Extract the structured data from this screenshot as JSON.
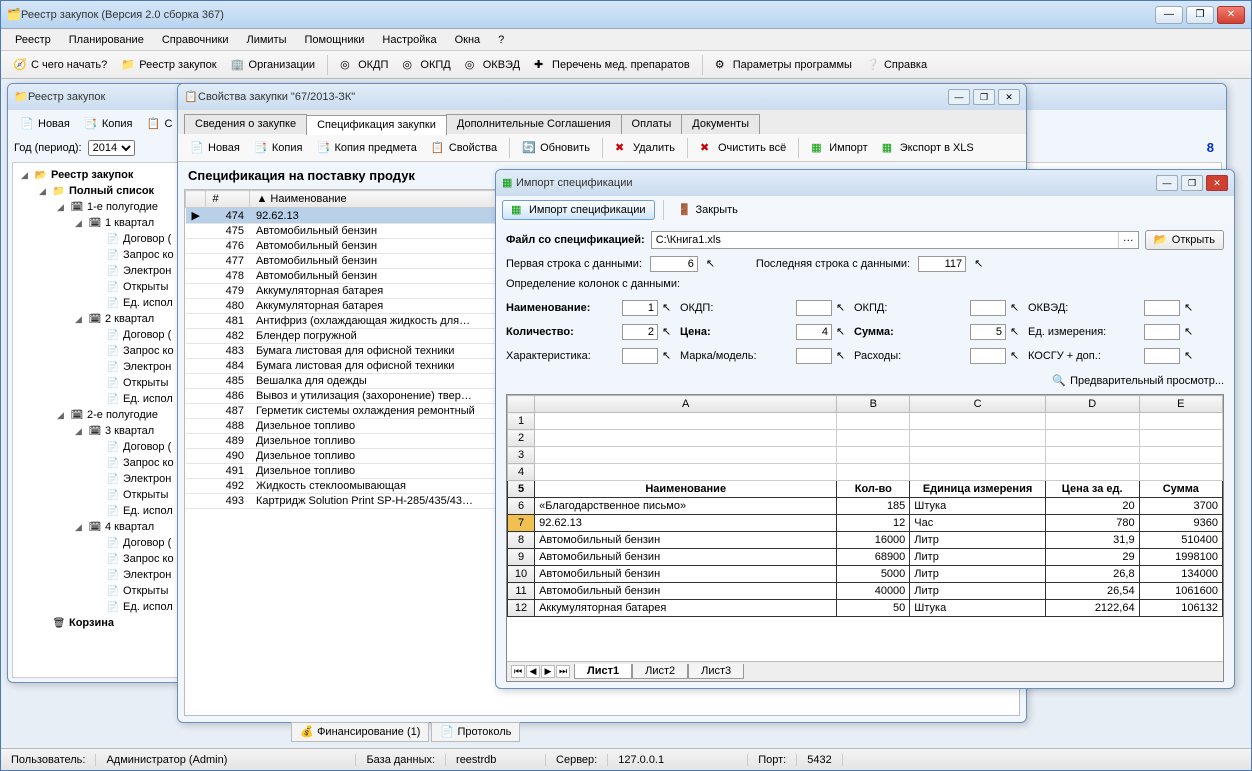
{
  "app": {
    "title": "Реестр закупок (Версия 2.0 сборка 367)"
  },
  "menu": [
    "Реестр",
    "Планирование",
    "Справочники",
    "Лимиты",
    "Помощники",
    "Настройка",
    "Окна",
    "?"
  ],
  "toolbar": {
    "start": "С чего начать?",
    "registry": "Реестр закупок",
    "orgs": "Организации",
    "okdp": "ОКДП",
    "okpd": "ОКПД",
    "okved": "ОКВЭД",
    "med": "Перечень мед. препаратов",
    "params": "Параметры программы",
    "help": "Справка"
  },
  "registry": {
    "title": "Реестр закупок",
    "tb": {
      "new": "Новая",
      "copy": "Копия",
      "more": "С"
    },
    "year_label": "Год (период):",
    "year": "2014",
    "count": "8",
    "tree": {
      "root": "Реестр закупок",
      "full": "Полный список",
      "h1": "1-е полугодие",
      "q1": "1 квартал",
      "q2": "2 квартал",
      "q3": "3 квартал",
      "q4": "4 квартал",
      "h2": "2-е полугодие",
      "items": [
        "Договор (",
        "Запрос ко",
        "Электрон",
        "Открыты",
        "Ед. испол"
      ],
      "trash": "Корзина"
    }
  },
  "props": {
    "title": "Свойства закупки \"67/2013-ЗК\"",
    "tabs": [
      "Сведения о закупке",
      "Спецификация закупки",
      "Дополнительные Соглашения",
      "Оплаты",
      "Документы"
    ],
    "tb": {
      "new": "Новая",
      "copy": "Копия",
      "copyobj": "Копия предмета",
      "props": "Свойства",
      "refresh": "Обновить",
      "delete": "Удалить",
      "clear": "Очистить всё",
      "import": "Импорт",
      "export": "Экспорт в XLS"
    },
    "spec_title": "Спецификация на поставку продук",
    "cols": {
      "num": "#",
      "name": "Наименование"
    },
    "rows": [
      {
        "n": 474,
        "name": "92.62.13"
      },
      {
        "n": 475,
        "name": "Автомобильный бензин"
      },
      {
        "n": 476,
        "name": "Автомобильный бензин"
      },
      {
        "n": 477,
        "name": "Автомобильный бензин"
      },
      {
        "n": 478,
        "name": "Автомобильный бензин"
      },
      {
        "n": 479,
        "name": "Аккумуляторная батарея"
      },
      {
        "n": 480,
        "name": "Аккумуляторная батарея"
      },
      {
        "n": 481,
        "name": "Антифриз (охлаждающая жидкость для…"
      },
      {
        "n": 482,
        "name": "Блендер погружной"
      },
      {
        "n": 483,
        "name": "Бумага листовая для офисной техники"
      },
      {
        "n": 484,
        "name": "Бумага листовая для офисной техники"
      },
      {
        "n": 485,
        "name": "Вешалка для одежды"
      },
      {
        "n": 486,
        "name": "Вывоз и утилизация (захоронение) твер…"
      },
      {
        "n": 487,
        "name": "Герметик системы охлаждения ремонтный"
      },
      {
        "n": 488,
        "name": "Дизельное топливо"
      },
      {
        "n": 489,
        "name": "Дизельное топливо"
      },
      {
        "n": 490,
        "name": "Дизельное топливо"
      },
      {
        "n": 491,
        "name": "Дизельное топливо"
      },
      {
        "n": 492,
        "name": "Жидкость стеклоомывающая"
      },
      {
        "n": 493,
        "name": "Картридж Solution Print SP-H-285/435/43…"
      }
    ],
    "bottom_tabs": [
      "Финансирование (1)",
      "Протоколь"
    ]
  },
  "import": {
    "title": "Импорт спецификации",
    "tb": {
      "import": "Импорт спецификации",
      "close": "Закрыть"
    },
    "file_label": "Файл со спецификацией:",
    "file": "C:\\Книга1.xls",
    "open": "Открыть",
    "first_row_label": "Первая строка с данными:",
    "first_row": "6",
    "last_row_label": "Последняя строка с данными:",
    "last_row": "117",
    "cols_label": "Определение колонок с данными:",
    "fields": {
      "name": {
        "label": "Наименование:",
        "val": "1"
      },
      "okdp": {
        "label": "ОКДП:",
        "val": ""
      },
      "okpd": {
        "label": "ОКПД:",
        "val": ""
      },
      "okved": {
        "label": "ОКВЭД:",
        "val": ""
      },
      "qty": {
        "label": "Количество:",
        "val": "2"
      },
      "price": {
        "label": "Цена:",
        "val": "4"
      },
      "sum": {
        "label": "Сумма:",
        "val": "5"
      },
      "unit": {
        "label": "Ед. измерения:",
        "val": ""
      },
      "char": {
        "label": "Характеристика:",
        "val": ""
      },
      "model": {
        "label": "Марка/модель:",
        "val": ""
      },
      "exp": {
        "label": "Расходы:",
        "val": ""
      },
      "kosgu": {
        "label": "КОСГУ + доп.:",
        "val": ""
      }
    },
    "preview": "Предварительный просмотр...",
    "excel": {
      "cols": [
        "A",
        "B",
        "C",
        "D",
        "E"
      ],
      "header": [
        "Наименование",
        "Кол-во",
        "Единица измерения",
        "Цена за ед.",
        "Сумма"
      ],
      "header_row": "5",
      "rows": [
        {
          "r": "6",
          "a": "«Благодарственное письмо»",
          "b": "185",
          "c": "Штука",
          "d": "20",
          "e": "3700"
        },
        {
          "r": "7",
          "a": "92.62.13",
          "b": "12",
          "c": "Час",
          "d": "780",
          "e": "9360"
        },
        {
          "r": "8",
          "a": "Автомобильный бензин",
          "b": "16000",
          "c": "Литр",
          "d": "31,9",
          "e": "510400"
        },
        {
          "r": "9",
          "a": "Автомобильный бензин",
          "b": "68900",
          "c": "Литр",
          "d": "29",
          "e": "1998100"
        },
        {
          "r": "10",
          "a": "Автомобильный бензин",
          "b": "5000",
          "c": "Литр",
          "d": "26,8",
          "e": "134000"
        },
        {
          "r": "11",
          "a": "Автомобильный бензин",
          "b": "40000",
          "c": "Литр",
          "d": "26,54",
          "e": "1061600"
        },
        {
          "r": "12",
          "a": "Аккумуляторная батарея",
          "b": "50",
          "c": "Штука",
          "d": "2122,64",
          "e": "106132"
        }
      ],
      "sheets": [
        "Лист1",
        "Лист2",
        "Лист3"
      ]
    }
  },
  "status": {
    "user_label": "Пользователь:",
    "user": "Администратор (Admin)",
    "db_label": "База данных:",
    "db": "reestrdb",
    "server_label": "Сервер:",
    "server": "127.0.0.1",
    "port_label": "Порт:",
    "port": "5432"
  }
}
